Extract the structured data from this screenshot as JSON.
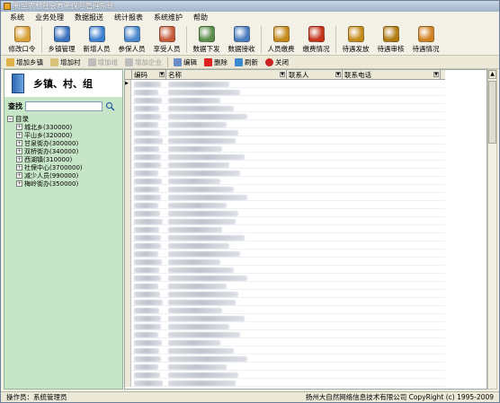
{
  "window": {
    "title": "新型农村社会养老保险管理系统"
  },
  "menu": [
    "系统",
    "业务处理",
    "数据报送",
    "统计报表",
    "系统维护",
    "帮助"
  ],
  "toolbar": [
    {
      "label": "修改口令",
      "icon": "lock-icon",
      "color": "#d8a23a"
    },
    {
      "label": "乡镇管理",
      "icon": "building-icon",
      "color": "#3a72c0"
    },
    {
      "label": "新增人员",
      "icon": "add-person-icon",
      "color": "#3e7fd0"
    },
    {
      "label": "参保人员",
      "icon": "people-icon",
      "color": "#4a88cc"
    },
    {
      "label": "享受人员",
      "icon": "people-benefit-icon",
      "color": "#c55a3a"
    },
    {
      "label": "数据下发",
      "icon": "data-download-icon",
      "color": "#5a8c4a"
    },
    {
      "label": "数据接收",
      "icon": "data-receive-icon",
      "color": "#4a7cc0"
    },
    {
      "label": "人员缴费",
      "icon": "payment-icon",
      "color": "#c48a1a"
    },
    {
      "label": "缴费情况",
      "icon": "payment-status-icon",
      "color": "#c4321a"
    },
    {
      "label": "待遇发放",
      "icon": "money-bag-icon",
      "color": "#c48a1a"
    },
    {
      "label": "待遇审核",
      "icon": "money-audit-icon",
      "color": "#b07a10"
    },
    {
      "label": "待遇情况",
      "icon": "benefit-status-icon",
      "color": "#d08020"
    }
  ],
  "subtoolbar": [
    {
      "label": "增加乡镇",
      "icon": "add-town-icon",
      "enabled": true
    },
    {
      "label": "增加村",
      "icon": "add-village-icon",
      "enabled": true
    },
    {
      "label": "增加组",
      "icon": "add-group-icon",
      "enabled": false
    },
    {
      "label": "增加企业",
      "icon": "add-enterprise-icon",
      "enabled": false
    },
    {
      "label": "编辑",
      "icon": "edit-icon",
      "enabled": true
    },
    {
      "label": "删除",
      "icon": "delete-icon",
      "enabled": true
    },
    {
      "label": "刷新",
      "icon": "refresh-icon",
      "enabled": true
    },
    {
      "label": "关闭",
      "icon": "close-icon",
      "enabled": true
    }
  ],
  "left": {
    "title": "乡镇、村、组",
    "search_label": "查找",
    "search_value": "",
    "tree_root": "目录",
    "tree_items": [
      "城北乡(330000)",
      "平山乡(320000)",
      "甘泉街办(300000)",
      "双桥街办(340000)",
      "西湖镇(310000)",
      "社保中心(3700000)",
      "减少人员(990000)",
      "梅岭街办(350000)"
    ]
  },
  "grid": {
    "columns": [
      "编码",
      "名称",
      "联系人",
      "联系电话"
    ],
    "rows": 38
  },
  "status": {
    "operator": "操作员：系统管理员",
    "copyright": "扬州大自然网络信息技术有限公司 CopyRight (c) 1995-2009"
  }
}
